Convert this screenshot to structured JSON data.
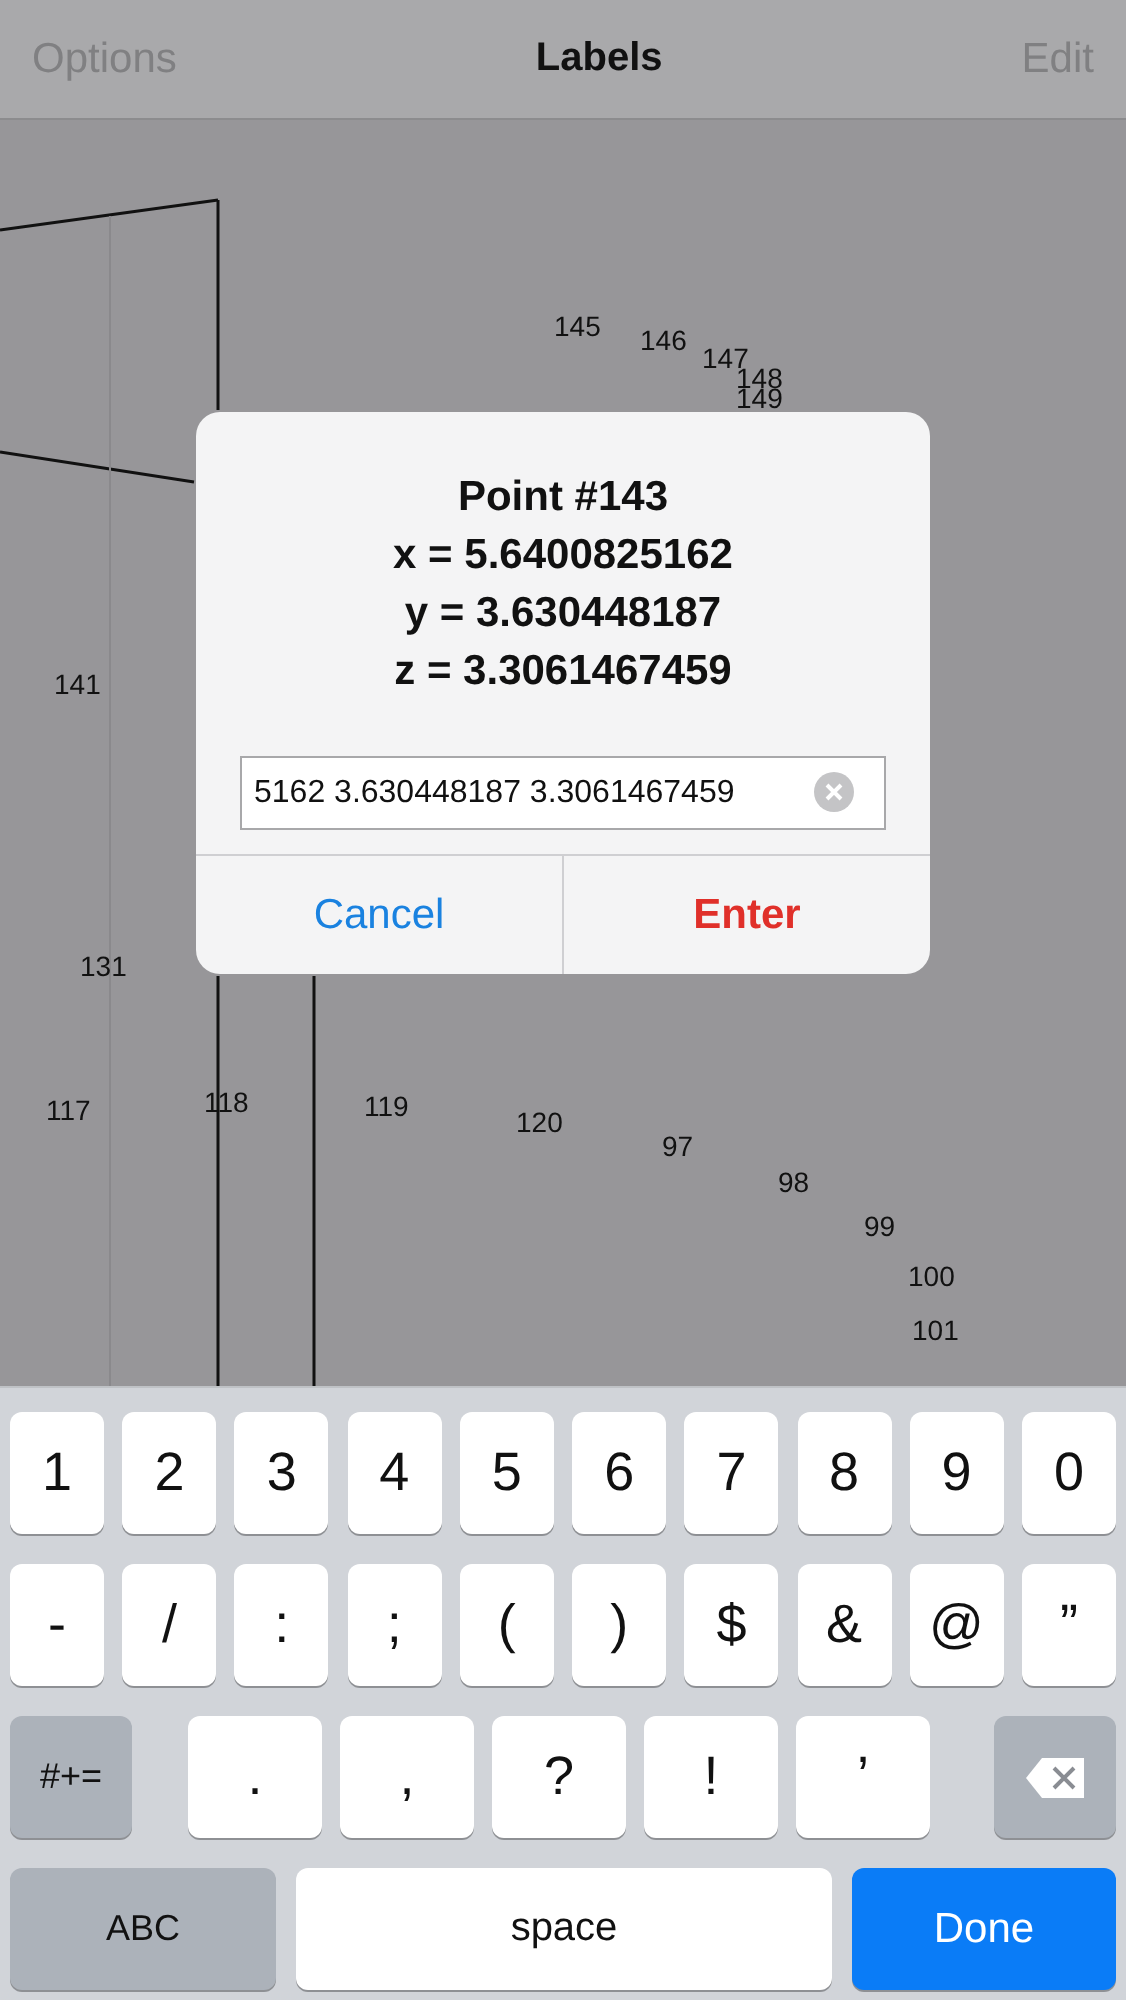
{
  "nav_bar": {
    "left": "Options",
    "title": "Labels",
    "right": "Edit",
    "dimmed": true
  },
  "canvas": {
    "point_labels": [
      "145",
      "146",
      "147",
      "148",
      "149",
      "141",
      "131",
      "117",
      "118",
      "119",
      "120",
      "97",
      "98",
      "99",
      "100",
      "101"
    ]
  },
  "dialog": {
    "title": "Point #143",
    "lines": [
      "x = 5.6400825162",
      "y = 3.630448187",
      "z = 3.3061467459"
    ],
    "field": {
      "value": "5162 3.630448187 3.3061467459"
    },
    "buttons": [
      {
        "label": "Cancel",
        "kind": "cancel"
      },
      {
        "label": "Enter",
        "kind": "default"
      }
    ]
  },
  "keyboard": {
    "rows": [
      {
        "keys": [
          {
            "kind": "char",
            "label": "1"
          },
          {
            "kind": "char",
            "label": "2"
          },
          {
            "kind": "char",
            "label": "3"
          },
          {
            "kind": "char",
            "label": "4"
          },
          {
            "kind": "char",
            "label": "5"
          },
          {
            "kind": "char",
            "label": "6"
          },
          {
            "kind": "char",
            "label": "7"
          },
          {
            "kind": "char",
            "label": "8"
          },
          {
            "kind": "char",
            "label": "9"
          },
          {
            "kind": "char",
            "label": "0"
          }
        ]
      },
      {
        "keys": [
          {
            "kind": "char",
            "label": "-"
          },
          {
            "kind": "char",
            "label": "/"
          },
          {
            "kind": "char",
            "label": ":"
          },
          {
            "kind": "char",
            "label": ";"
          },
          {
            "kind": "char",
            "label": "("
          },
          {
            "kind": "char",
            "label": ")"
          },
          {
            "kind": "char",
            "label": "$"
          },
          {
            "kind": "char",
            "label": "&"
          },
          {
            "kind": "char",
            "label": "@"
          },
          {
            "kind": "char",
            "label": "”"
          }
        ]
      },
      {
        "keys": [
          {
            "kind": "modifier",
            "label": "#+="
          },
          {
            "kind": "wide",
            "label": "."
          },
          {
            "kind": "wide",
            "label": ","
          },
          {
            "kind": "wide",
            "label": "?"
          },
          {
            "kind": "wide",
            "label": "!"
          },
          {
            "kind": "wide",
            "label": "’"
          },
          {
            "kind": "delete"
          }
        ]
      },
      {
        "keys": [
          {
            "kind": "mode",
            "label": "ABC"
          },
          {
            "kind": "space",
            "label": "space"
          },
          {
            "kind": "done",
            "label": "Done"
          }
        ]
      }
    ]
  }
}
